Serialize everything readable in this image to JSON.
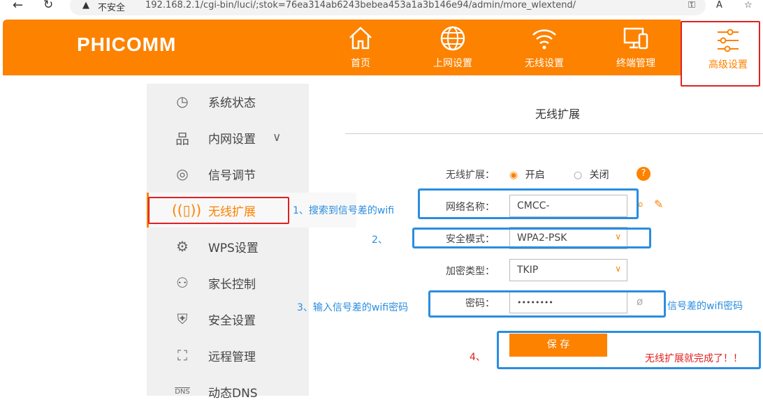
{
  "browser": {
    "insecure": "不安全",
    "url": "192.168.2.1/cgi-bin/luci/;stok=76ea314ab6243bebea453a1a3b146e94/admin/more_wlextend/"
  },
  "header": {
    "logo": "PHICOMM",
    "nav": [
      {
        "label": "首页",
        "icon": "home-icon"
      },
      {
        "label": "上网设置",
        "icon": "globe-icon"
      },
      {
        "label": "无线设置",
        "icon": "wifi-icon"
      },
      {
        "label": "终端管理",
        "icon": "devices-icon"
      },
      {
        "label": "高级设置",
        "icon": "sliders-icon",
        "active": true
      }
    ]
  },
  "sidebar": {
    "items": [
      {
        "label": "系统状态",
        "icon": "clock-icon"
      },
      {
        "label": "内网设置",
        "icon": "network-icon"
      },
      {
        "label": "信号调节",
        "icon": "signal-icon"
      },
      {
        "label": "无线扩展",
        "icon": "antenna-icon",
        "active": true
      },
      {
        "label": "WPS设置",
        "icon": "wps-gear-icon"
      },
      {
        "label": "家长控制",
        "icon": "parent-lock-icon"
      },
      {
        "label": "安全设置",
        "icon": "shield-icon"
      },
      {
        "label": "远程管理",
        "icon": "remote-icon"
      },
      {
        "label": "动态DNS",
        "icon": "dns-icon",
        "icon_text": "DNS"
      }
    ]
  },
  "main": {
    "title": "无线扩展",
    "form": {
      "ext_label": "无线扩展：",
      "on": "开启",
      "off": "关闭",
      "ssid_label": "网络名称：",
      "ssid": "CMCC-",
      "sec_label": "安全模式：",
      "sec": "WPA2-PSK",
      "enc_label": "加密类型：",
      "enc": "TKIP",
      "pwd_label": "密码：",
      "pwd": "••••••••",
      "save": "保 存"
    }
  },
  "annotations": {
    "a1": "1、搜索到信号差的wifi",
    "a2": "2、",
    "a3": "3、输入信号差的wifi密码",
    "a3r": "信号差的wifi密码",
    "a4": "4、",
    "done": "无线扩展就完成了！！"
  }
}
